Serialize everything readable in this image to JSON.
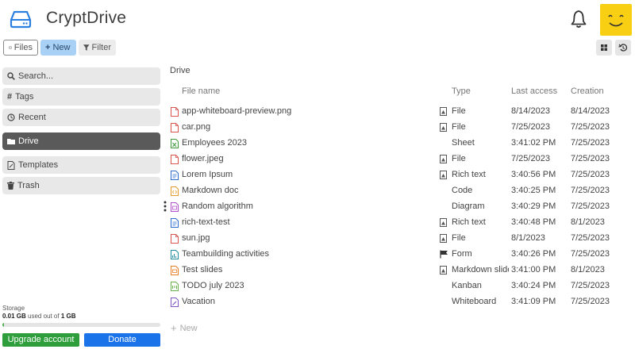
{
  "app": {
    "title": "CryptDrive"
  },
  "toolbar": {
    "files_label": "Files",
    "new_label": "New",
    "filter_label": "Filter"
  },
  "sidebar": {
    "items": [
      {
        "label": "Search...",
        "icon": "search-icon"
      },
      {
        "label": "Tags",
        "icon": "hash-icon"
      },
      {
        "label": "Recent",
        "icon": "clock-icon"
      },
      {
        "label": "Drive",
        "icon": "folder-icon",
        "active": true
      },
      {
        "label": "Templates",
        "icon": "template-icon"
      },
      {
        "label": "Trash",
        "icon": "trash-icon"
      }
    ],
    "storage": {
      "title": "Storage",
      "used": "0.01 GB",
      "used_mid": " used out of ",
      "total": "1 GB",
      "fraction_used": 0.01
    },
    "upgrade_label": "Upgrade account",
    "donate_label": "Donate"
  },
  "main": {
    "breadcrumb": "Drive",
    "columns": {
      "name": "File name",
      "type": "Type",
      "access": "Last access",
      "creation": "Creation"
    },
    "rows": [
      {
        "name": "app-whiteboard-preview.png",
        "type": "File",
        "access": "8/14/2023",
        "creation": "8/14/2023",
        "icon": "image-file-icon",
        "type_icon": "file-type-icon"
      },
      {
        "name": "car.png",
        "type": "File",
        "access": "7/25/2023",
        "creation": "7/25/2023",
        "icon": "image-file-icon",
        "type_icon": "file-type-icon"
      },
      {
        "name": "Employees 2023",
        "type": "Sheet",
        "access": "3:41:02 PM",
        "creation": "7/25/2023",
        "icon": "sheet-icon",
        "type_icon": ""
      },
      {
        "name": "flower.jpeg",
        "type": "File",
        "access": "7/25/2023",
        "creation": "7/25/2023",
        "icon": "image-file-icon",
        "type_icon": "file-type-icon"
      },
      {
        "name": "Lorem Ipsum",
        "type": "Rich text",
        "access": "3:40:56 PM",
        "creation": "7/25/2023",
        "icon": "richtext-icon",
        "type_icon": "file-type-icon"
      },
      {
        "name": "Markdown doc",
        "type": "Code",
        "access": "3:40:25 PM",
        "creation": "7/25/2023",
        "icon": "code-icon",
        "type_icon": ""
      },
      {
        "name": "Random algorithm",
        "type": "Diagram",
        "access": "3:40:29 PM",
        "creation": "7/25/2023",
        "icon": "diagram-icon",
        "type_icon": ""
      },
      {
        "name": "rich-text-test",
        "type": "Rich text",
        "access": "3:40:48 PM",
        "creation": "8/1/2023",
        "icon": "richtext-icon",
        "type_icon": "file-type-icon"
      },
      {
        "name": "sun.jpg",
        "type": "File",
        "access": "8/1/2023",
        "creation": "7/25/2023",
        "icon": "image-file-icon",
        "type_icon": "file-type-icon"
      },
      {
        "name": "Teambuilding activities",
        "type": "Form",
        "access": "3:40:26 PM",
        "creation": "7/25/2023",
        "icon": "form-icon",
        "type_icon": "flag-icon"
      },
      {
        "name": "Test slides",
        "type": "Markdown slides",
        "access": "3:41:00 PM",
        "creation": "8/1/2023",
        "icon": "slides-icon",
        "type_icon": "file-type-icon"
      },
      {
        "name": "TODO july 2023",
        "type": "Kanban",
        "access": "3:40:24 PM",
        "creation": "7/25/2023",
        "icon": "kanban-icon",
        "type_icon": ""
      },
      {
        "name": "Vacation",
        "type": "Whiteboard",
        "access": "3:41:09 PM",
        "creation": "7/25/2023",
        "icon": "whiteboard-icon",
        "type_icon": ""
      }
    ],
    "new_label": "New"
  },
  "colors": {
    "accent": "#1a73e8",
    "new_button": "#a8d1f5",
    "upgrade": "#2e9e3c",
    "avatar": "#f9cf14",
    "active_sidebar": "#5a5a5a"
  }
}
